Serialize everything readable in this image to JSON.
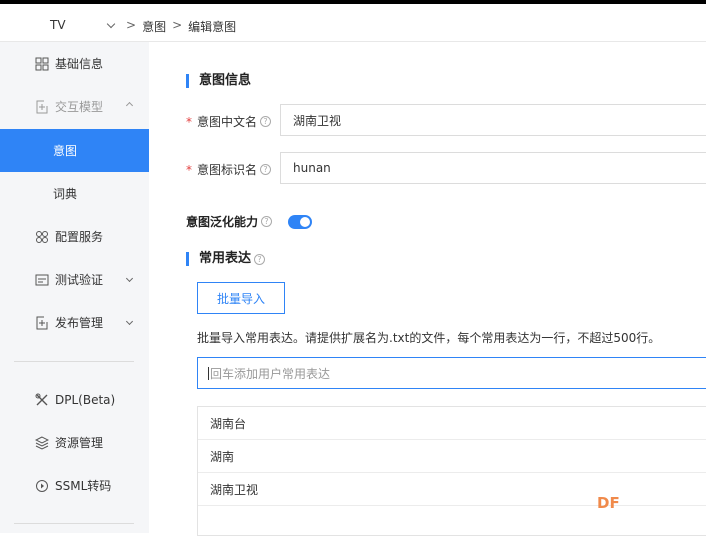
{
  "topbar": {
    "app_name": "TV",
    "breadcrumb": [
      ">",
      "意图",
      ">",
      "编辑意图"
    ]
  },
  "sidebar": {
    "items": [
      {
        "label": "基础信息",
        "icon": "grid-icon"
      },
      {
        "label": "交互模型",
        "icon": "export-icon"
      },
      {
        "label": "意图"
      },
      {
        "label": "词典"
      },
      {
        "label": "配置服务",
        "icon": "settings-cluster-icon"
      },
      {
        "label": "测试验证",
        "icon": "monitor-icon"
      },
      {
        "label": "发布管理",
        "icon": "publish-icon"
      },
      {
        "label": "DPL(Beta)",
        "icon": "tools-icon"
      },
      {
        "label": "资源管理",
        "icon": "layers-icon"
      },
      {
        "label": "SSML转码",
        "icon": "transcode-icon"
      }
    ]
  },
  "intent_info": {
    "title": "意图信息",
    "cn_name_label": "意图中文名",
    "cn_name_value": "湖南卫视",
    "id_name_label": "意图标识名",
    "id_name_value": "hunan",
    "generalize_label": "意图泛化能力",
    "generalize_on": true
  },
  "expressions": {
    "title": "常用表达",
    "import_button": "批量导入",
    "hint": "批量导入常用表达。请提供扩展名为.txt的文件，每个常用表达为一行，不超过500行。",
    "add_placeholder": "回车添加用户常用表达",
    "items": [
      "湖南台",
      "湖南",
      "湖南卫视"
    ]
  },
  "watermark": "DF",
  "colors": {
    "accent": "#2f84f6",
    "required": "#e34040",
    "watermark": "#f08a4b"
  }
}
